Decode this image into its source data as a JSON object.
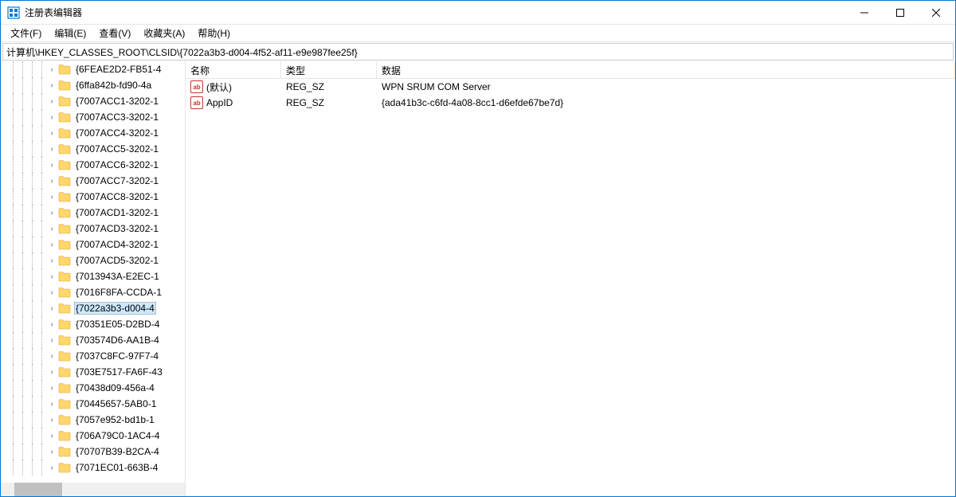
{
  "window": {
    "title": "注册表编辑器"
  },
  "menu": {
    "file": "文件(F)",
    "edit": "编辑(E)",
    "view": "查看(V)",
    "favorites": "收藏夹(A)",
    "help": "帮助(H)"
  },
  "addressbar": {
    "path": "计算机\\HKEY_CLASSES_ROOT\\CLSID\\{7022a3b3-d004-4f52-af11-e9e987fee25f}"
  },
  "tree": {
    "items": [
      {
        "label": "{6FEAE2D2-FB51-4",
        "selected": false
      },
      {
        "label": "{6ffa842b-fd90-4a",
        "selected": false
      },
      {
        "label": "{7007ACC1-3202-1",
        "selected": false
      },
      {
        "label": "{7007ACC3-3202-1",
        "selected": false
      },
      {
        "label": "{7007ACC4-3202-1",
        "selected": false
      },
      {
        "label": "{7007ACC5-3202-1",
        "selected": false
      },
      {
        "label": "{7007ACC6-3202-1",
        "selected": false
      },
      {
        "label": "{7007ACC7-3202-1",
        "selected": false
      },
      {
        "label": "{7007ACC8-3202-1",
        "selected": false
      },
      {
        "label": "{7007ACD1-3202-1",
        "selected": false
      },
      {
        "label": "{7007ACD3-3202-1",
        "selected": false
      },
      {
        "label": "{7007ACD4-3202-1",
        "selected": false
      },
      {
        "label": "{7007ACD5-3202-1",
        "selected": false
      },
      {
        "label": "{7013943A-E2EC-1",
        "selected": false
      },
      {
        "label": "{7016F8FA-CCDA-1",
        "selected": false
      },
      {
        "label": "{7022a3b3-d004-4",
        "selected": true
      },
      {
        "label": "{70351E05-D2BD-4",
        "selected": false
      },
      {
        "label": "{703574D6-AA1B-4",
        "selected": false
      },
      {
        "label": "{7037C8FC-97F7-4",
        "selected": false
      },
      {
        "label": "{703E7517-FA6F-43",
        "selected": false
      },
      {
        "label": "{70438d09-456a-4",
        "selected": false
      },
      {
        "label": "{70445657-5AB0-1",
        "selected": false
      },
      {
        "label": "{7057e952-bd1b-1",
        "selected": false
      },
      {
        "label": "{706A79C0-1AC4-4",
        "selected": false
      },
      {
        "label": "{70707B39-B2CA-4",
        "selected": false
      },
      {
        "label": "{7071EC01-663B-4",
        "selected": false
      }
    ]
  },
  "list": {
    "headers": {
      "name": "名称",
      "type": "类型",
      "data": "数据"
    },
    "rows": [
      {
        "name": "(默认)",
        "type": "REG_SZ",
        "data": "WPN SRUM COM Server"
      },
      {
        "name": "AppID",
        "type": "REG_SZ",
        "data": "{ada41b3c-c6fd-4a08-8cc1-d6efde67be7d}"
      }
    ]
  }
}
